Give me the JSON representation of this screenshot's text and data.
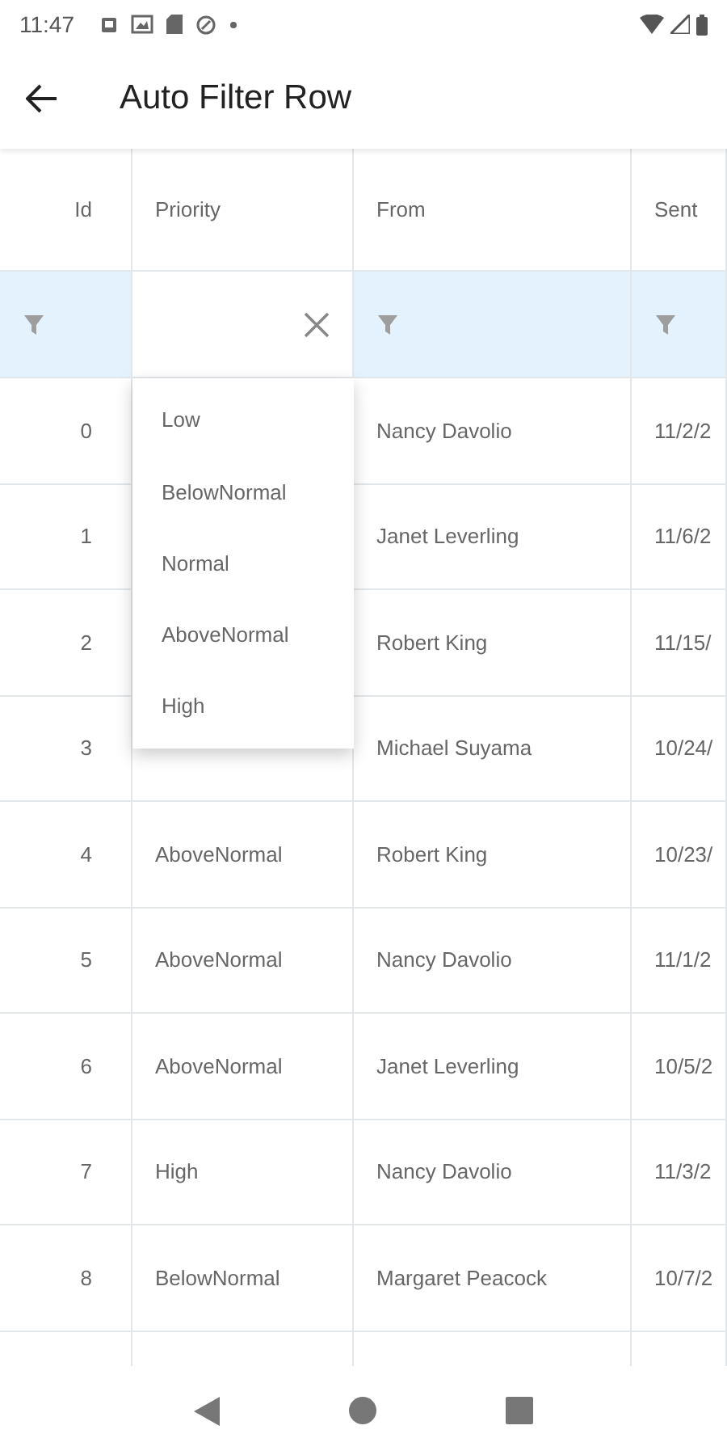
{
  "status_bar": {
    "time": "11:47"
  },
  "app_bar": {
    "title": "Auto Filter Row"
  },
  "table": {
    "columns": [
      "Id",
      "Priority",
      "From",
      "Sent"
    ],
    "filter_cells": [
      {
        "active": false
      },
      {
        "active": true
      },
      {
        "active": false
      },
      {
        "active": false
      }
    ],
    "rows": [
      {
        "id": "0",
        "from": "Nancy Davolio",
        "sent": "11/2/2"
      },
      {
        "id": "1",
        "from": "Janet Leverling",
        "sent": "11/6/2"
      },
      {
        "id": "2",
        "from": "Robert King",
        "sent": "11/15/"
      },
      {
        "id": "3",
        "from": "Michael Suyama",
        "sent": "10/24/"
      },
      {
        "id": "4",
        "priority": "AboveNormal",
        "from": "Robert King",
        "sent": "10/23/"
      },
      {
        "id": "5",
        "priority": "AboveNormal",
        "from": "Nancy Davolio",
        "sent": "11/1/2"
      },
      {
        "id": "6",
        "priority": "AboveNormal",
        "from": "Janet Leverling",
        "sent": "10/5/2"
      },
      {
        "id": "7",
        "priority": "High",
        "from": "Nancy Davolio",
        "sent": "11/3/2"
      },
      {
        "id": "8",
        "priority": "BelowNormal",
        "from": "Margaret Peacock",
        "sent": "10/7/2"
      }
    ]
  },
  "dropdown": {
    "items": [
      "Low",
      "BelowNormal",
      "Normal",
      "AboveNormal",
      "High"
    ]
  }
}
